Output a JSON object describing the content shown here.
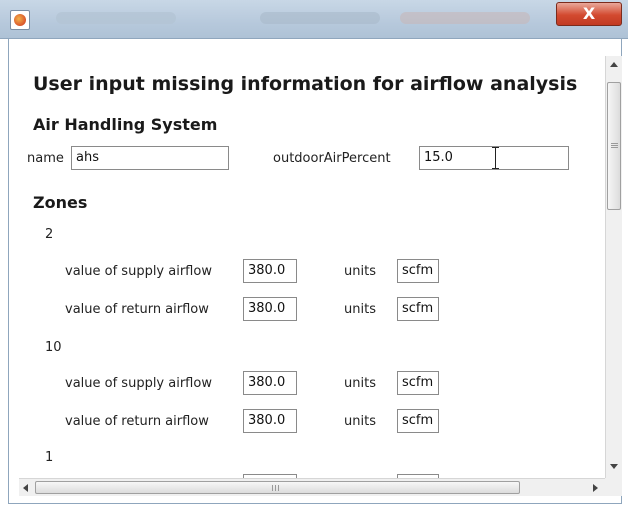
{
  "window": {
    "close_label": "X"
  },
  "form": {
    "heading": "User input missing information for airflow analysis",
    "ahs_heading": "Air Handling System",
    "name_label": "name",
    "name_value": "ahs",
    "outdoor_label": "outdoorAirPercent",
    "outdoor_value": "15.0",
    "zones_heading": "Zones",
    "zones": [
      {
        "id": "2",
        "supply_label": "value of supply airflow",
        "supply_value": "380.0",
        "supply_units_label": "units",
        "supply_units_value": "scfm",
        "return_label": "value of return airflow",
        "return_value": "380.0",
        "return_units_label": "units",
        "return_units_value": "scfm"
      },
      {
        "id": "10",
        "supply_label": "value of supply airflow",
        "supply_value": "380.0",
        "supply_units_label": "units",
        "supply_units_value": "scfm",
        "return_label": "value of return airflow",
        "return_value": "380.0",
        "return_units_label": "units",
        "return_units_value": "scfm"
      },
      {
        "id": "1"
      }
    ]
  },
  "scroll": {
    "hgrip": "III"
  }
}
